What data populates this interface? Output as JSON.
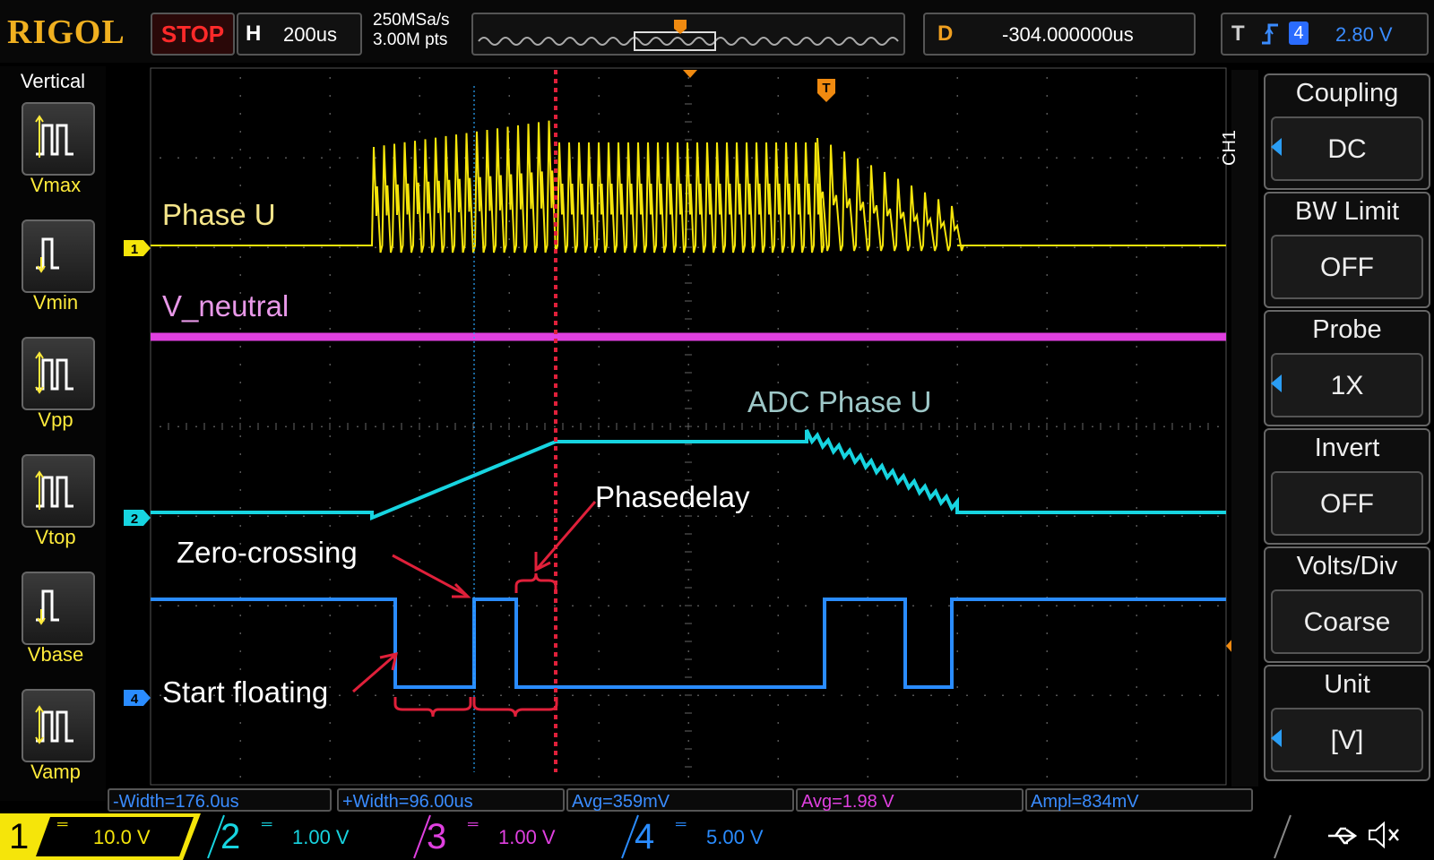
{
  "brand": "RIGOL",
  "status": "STOP",
  "horizontal": {
    "key": "H",
    "value": "200us"
  },
  "sample_rate": "250MSa/s",
  "memory_depth": "3.00M pts",
  "delay": {
    "key": "D",
    "value": "-304.000000us"
  },
  "trigger": {
    "key": "T",
    "source": "4",
    "level": "2.80 V"
  },
  "vertical_menu": {
    "title": "Vertical",
    "items": [
      {
        "label": "Vmax"
      },
      {
        "label": "Vmin"
      },
      {
        "label": "Vpp"
      },
      {
        "label": "Vtop"
      },
      {
        "label": "Vbase"
      },
      {
        "label": "Vamp"
      }
    ]
  },
  "channel_menu": {
    "channel_tag": "CH1",
    "items": [
      {
        "title": "Coupling",
        "value": "DC"
      },
      {
        "title": "BW Limit",
        "value": "OFF"
      },
      {
        "title": "Probe",
        "value": "1X"
      },
      {
        "title": "Invert",
        "value": "OFF"
      },
      {
        "title": "Volts/Div",
        "value": "Coarse"
      },
      {
        "title": "Unit",
        "value": "[V]"
      }
    ]
  },
  "measurements": [
    {
      "text": "-Width=176.0us",
      "color": "#3a8cff"
    },
    {
      "text": "+Width=96.00us",
      "color": "#3a8cff"
    },
    {
      "text": "Avg=359mV",
      "color": "#3a8cff"
    },
    {
      "text": "Avg=1.98 V",
      "color": "#e040e0"
    },
    {
      "text": "Ampl=834mV",
      "color": "#3a8cff"
    }
  ],
  "channels": [
    {
      "number": "1",
      "coupling_icon": "dc-coupling-icon",
      "scale": "10.0 V",
      "color": "#f5e50a"
    },
    {
      "number": "2",
      "coupling_icon": "dc-coupling-icon",
      "scale": "1.00 V",
      "color": "#17d4e0"
    },
    {
      "number": "3",
      "coupling_icon": "dc-coupling-icon",
      "scale": "1.00 V",
      "color": "#e040e0"
    },
    {
      "number": "4",
      "coupling_icon": "dc-coupling-icon",
      "scale": "5.00 V",
      "color": "#2a8cff"
    }
  ],
  "channel_markers": [
    "1",
    "2",
    "4"
  ],
  "trigger_marker": "T",
  "annotations": {
    "phase_u": "Phase U",
    "v_neutral": "V_neutral",
    "adc_phase_u": "ADC Phase U",
    "phasedelay": "Phasedelay",
    "zero_crossing": "Zero-crossing",
    "start_floating": "Start floating"
  },
  "status_icons": [
    "usb-icon",
    "speaker-muted-icon"
  ]
}
